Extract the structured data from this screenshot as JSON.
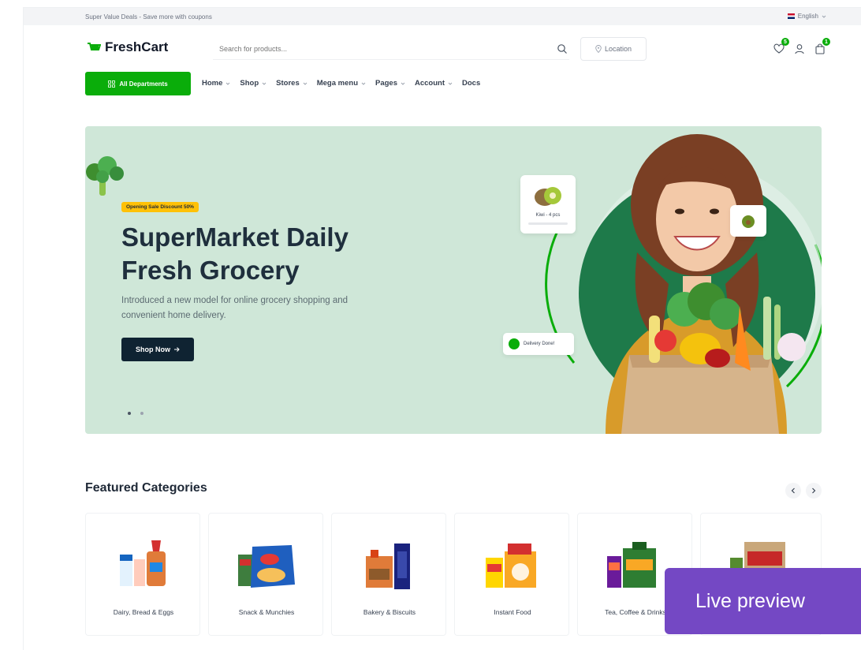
{
  "topbar": {
    "promo": "Super Value Deals - Save more with coupons",
    "language": "English"
  },
  "header": {
    "brand": "FreshCart",
    "search_placeholder": "Search for products...",
    "location_label": "Location",
    "wishlist_count": "5",
    "cart_count": "1"
  },
  "nav": {
    "departments_label": "All Departments",
    "items": [
      "Home",
      "Shop",
      "Stores",
      "Mega menu",
      "Pages",
      "Account",
      "Docs"
    ]
  },
  "hero": {
    "pill": "Opening Sale Discount 50%",
    "title_line1": "SuperMarket Daily",
    "title_line2": "Fresh Grocery",
    "subtitle": "Introduced a new model for online grocery shopping and convenient home delivery.",
    "button_label": "Shop Now",
    "kiwi_card": "Kiwi - 4 pcs",
    "delivery_card": "Delivery Done!"
  },
  "featured": {
    "title": "Featured Categories",
    "categories": [
      "Dairy, Bread & Eggs",
      "Snack & Munchies",
      "Bakery & Biscuits",
      "Instant Food",
      "Tea, Coffee & Drinks",
      ""
    ]
  },
  "overlay": {
    "live_preview": "Live preview"
  },
  "colors": {
    "brand_green": "#0aad0a",
    "hero_bg": "#cfe7d8",
    "dark_button": "#0f2332",
    "overlay_purple": "#7448c4",
    "pill_yellow": "#ffc107"
  }
}
